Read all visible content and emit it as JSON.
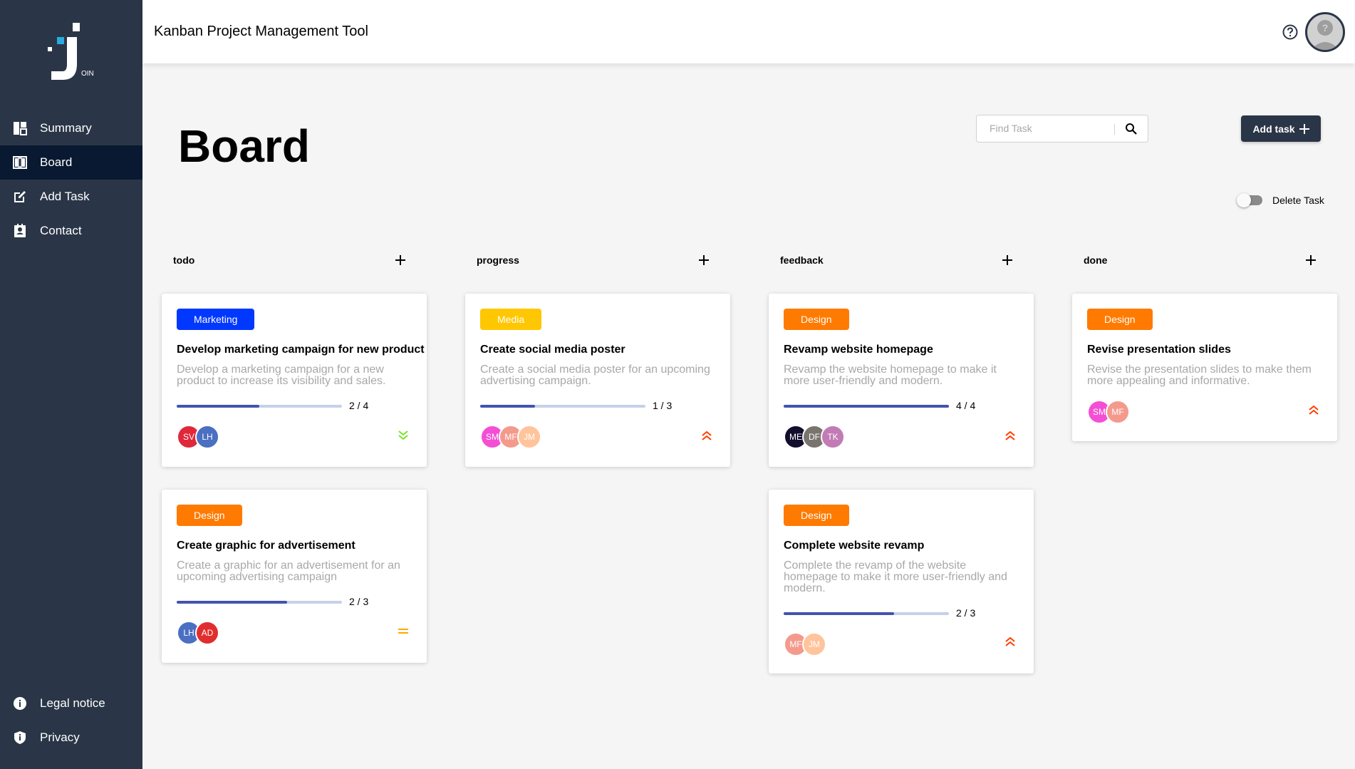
{
  "app": {
    "title": "Kanban Project Management Tool",
    "logo_text": "OIN"
  },
  "sidebar": {
    "items": [
      {
        "label": "Summary",
        "icon": "summary-icon",
        "active": false
      },
      {
        "label": "Board",
        "icon": "board-icon",
        "active": true
      },
      {
        "label": "Add Task",
        "icon": "add-task-icon",
        "active": false
      },
      {
        "label": "Contact",
        "icon": "contact-icon",
        "active": false
      }
    ],
    "bottom_items": [
      {
        "label": "Legal notice",
        "icon": "info-icon"
      },
      {
        "label": "Privacy",
        "icon": "privacy-icon"
      }
    ]
  },
  "page": {
    "title": "Board",
    "search_placeholder": "Find Task",
    "add_task_label": "Add task",
    "delete_task_label": "Delete Task"
  },
  "columns": [
    {
      "title": "todo"
    },
    {
      "title": "progress"
    },
    {
      "title": "feedback"
    },
    {
      "title": "done"
    }
  ],
  "cards": [
    {
      "category": "Marketing",
      "category_color": "#0038ff",
      "title": "Develop marketing campaign for new product",
      "description": "Develop a marketing campaign for a new product to increase its visibility and sales.",
      "progress_text": "2 / 4",
      "progress": 0.5,
      "assignees": [
        {
          "initials": "SV",
          "color": "#e0283a"
        },
        {
          "initials": "LH",
          "color": "#4a6fc3"
        }
      ],
      "priority": "low"
    },
    {
      "category": "Design",
      "category_color": "#ff7a00",
      "title": "Create graphic for advertisement",
      "description": "Create a graphic for an advertisement for an upcoming advertising campaign",
      "progress_text": "2 / 3",
      "progress": 0.667,
      "assignees": [
        {
          "initials": "LH",
          "color": "#4a6fc3"
        },
        {
          "initials": "AD",
          "color": "#e12d2d"
        }
      ],
      "priority": "medium"
    },
    {
      "category": "Media",
      "category_color": "#ffc701",
      "title": "Create social media poster",
      "description": "Create a social media poster for an upcoming advertising campaign.",
      "progress_text": "1 / 3",
      "progress": 0.333,
      "assignees": [
        {
          "initials": "SM",
          "color": "#f44fd4"
        },
        {
          "initials": "MF",
          "color": "#f49a8c"
        },
        {
          "initials": "JM",
          "color": "#ffc49c"
        }
      ],
      "priority": "urgent"
    },
    {
      "category": "Design",
      "category_color": "#ff7a00",
      "title": "Revamp website homepage",
      "description": "Revamp the website homepage to make it more user-friendly and modern.",
      "progress_text": "4 / 4",
      "progress": 1.0,
      "assignees": [
        {
          "initials": "ME",
          "color": "#130d2e"
        },
        {
          "initials": "DF",
          "color": "#7a746e"
        },
        {
          "initials": "TK",
          "color": "#c27bb4"
        }
      ],
      "priority": "urgent"
    },
    {
      "category": "Design",
      "category_color": "#ff7a00",
      "title": "Complete website revamp",
      "description": "Complete the revamp of the website homepage to make it more user-friendly and modern.",
      "progress_text": "2 / 3",
      "progress": 0.667,
      "assignees": [
        {
          "initials": "MF",
          "color": "#f49a8c"
        },
        {
          "initials": "JM",
          "color": "#ffc49c"
        }
      ],
      "priority": "urgent"
    },
    {
      "category": "Design",
      "category_color": "#ff7a00",
      "title": "Revise presentation slides",
      "description": "Revise the presentation slides to make them more appealing and informative.",
      "progress_text": "",
      "progress": null,
      "assignees": [
        {
          "initials": "SM",
          "color": "#f44fd4"
        },
        {
          "initials": "MF",
          "color": "#f49a8c"
        }
      ],
      "priority": "urgent"
    }
  ]
}
